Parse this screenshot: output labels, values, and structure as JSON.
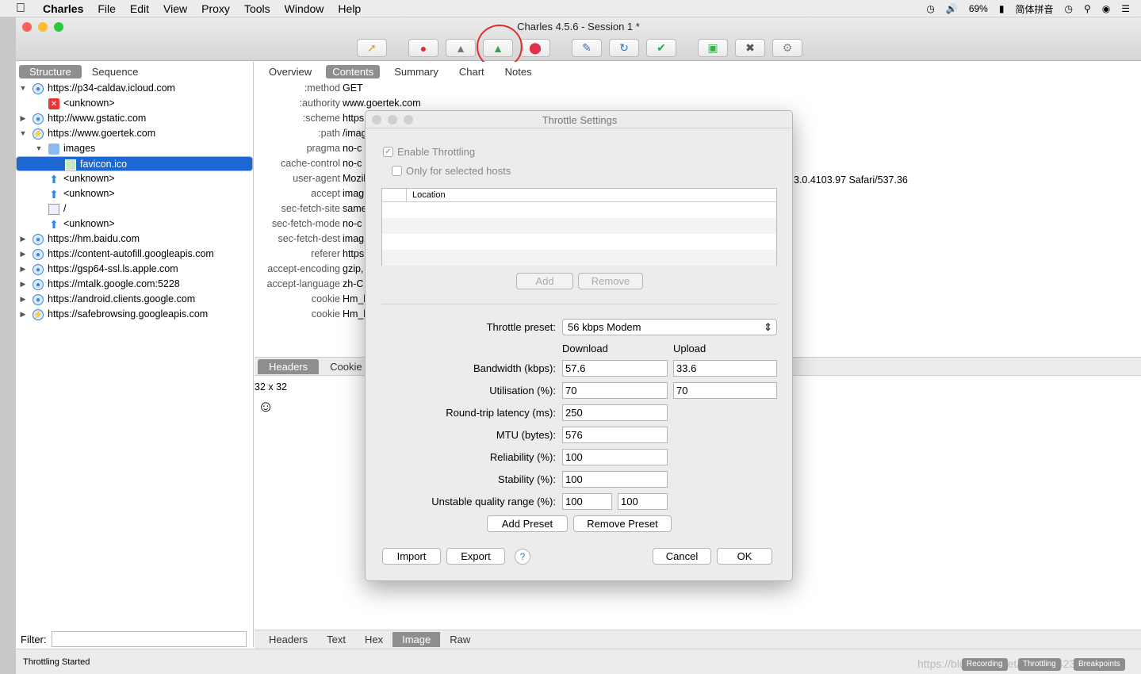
{
  "menubar": {
    "app": "Charles",
    "items": [
      "File",
      "Edit",
      "View",
      "Proxy",
      "Tools",
      "Window",
      "Help"
    ],
    "battery": "69%",
    "input_method": "简体拼音"
  },
  "window": {
    "title": "Charles 4.5.6 - Session 1 *"
  },
  "toolbar": {
    "buttons": [
      "broom-icon",
      "record-icon",
      "ssl-lock-icon",
      "throttle-turtle-icon",
      "breakpoint-stop-icon",
      "compose-pen-icon",
      "refresh-icon",
      "validate-check-icon",
      "basket-icon",
      "tools-icon",
      "settings-gear-icon"
    ]
  },
  "left": {
    "tabs": {
      "structure": "Structure",
      "sequence": "Sequence"
    },
    "tree": [
      {
        "label": "https://p34-caldav.icloud.com"
      },
      {
        "label": "<unknown>"
      },
      {
        "label": "http://www.gstatic.com"
      },
      {
        "label": "https://www.goertek.com"
      },
      {
        "label": "images"
      },
      {
        "label": "favicon.ico"
      },
      {
        "label": "<unknown>"
      },
      {
        "label": "<unknown>"
      },
      {
        "label": "/"
      },
      {
        "label": "<unknown>"
      },
      {
        "label": "https://hm.baidu.com"
      },
      {
        "label": "https://content-autofill.googleapis.com"
      },
      {
        "label": "https://gsp64-ssl.ls.apple.com"
      },
      {
        "label": "https://mtalk.google.com:5228"
      },
      {
        "label": "https://android.clients.google.com"
      },
      {
        "label": "https://safebrowsing.googleapis.com"
      }
    ],
    "filter_label": "Filter:"
  },
  "right": {
    "tabs": {
      "overview": "Overview",
      "contents": "Contents",
      "summary": "Summary",
      "chart": "Chart",
      "notes": "Notes"
    },
    "headers": [
      {
        "k": ":method",
        "v": "GET"
      },
      {
        "k": ":authority",
        "v": "www.goertek.com"
      },
      {
        "k": ":scheme",
        "v": "https"
      },
      {
        "k": ":path",
        "v": "/imag"
      },
      {
        "k": "pragma",
        "v": "no-c"
      },
      {
        "k": "cache-control",
        "v": "no-c"
      },
      {
        "k": "user-agent",
        "v": "Mozil"
      },
      {
        "k": "accept",
        "v": "imag"
      },
      {
        "k": "sec-fetch-site",
        "v": "same"
      },
      {
        "k": "sec-fetch-mode",
        "v": "no-c"
      },
      {
        "k": "sec-fetch-dest",
        "v": "imag"
      },
      {
        "k": "referer",
        "v": "https"
      },
      {
        "k": "accept-encoding",
        "v": "gzip,"
      },
      {
        "k": "accept-language",
        "v": "zh-C"
      },
      {
        "k": "cookie",
        "v": "Hm_l"
      },
      {
        "k": "cookie",
        "v": "Hm_l"
      }
    ],
    "ua_tail": "3.0.4103.97 Safari/537.36",
    "lower_tabs": {
      "headers": "Headers",
      "cookies": "Cookie"
    },
    "image_dim": "32 x 32",
    "bottom_tabs": {
      "headers": "Headers",
      "text": "Text",
      "hex": "Hex",
      "image": "Image",
      "raw": "Raw"
    }
  },
  "status": {
    "text": "Throttling Started",
    "recording": "Recording",
    "throttling": "Throttling",
    "breakpoints": "Breakpoints",
    "watermark": "https://blog.csdn.net/weixin_42382520"
  },
  "dialog": {
    "title": "Throttle Settings",
    "enable_throttling": "Enable Throttling",
    "only_selected": "Only for selected hosts",
    "location_header": "Location",
    "add": "Add",
    "remove": "Remove",
    "preset_label": "Throttle preset:",
    "preset_value": "56 kbps Modem",
    "col_download": "Download",
    "col_upload": "Upload",
    "bandwidth_label": "Bandwidth (kbps):",
    "bandwidth_down": "57.6",
    "bandwidth_up": "33.6",
    "utilisation_label": "Utilisation (%):",
    "utilisation_down": "70",
    "utilisation_up": "70",
    "latency_label": "Round-trip latency (ms):",
    "latency": "250",
    "mtu_label": "MTU (bytes):",
    "mtu": "576",
    "reliability_label": "Reliability (%):",
    "reliability": "100",
    "stability_label": "Stability (%):",
    "stability": "100",
    "unstable_label": "Unstable quality range (%):",
    "unstable_min": "100",
    "unstable_max": "100",
    "add_preset": "Add Preset",
    "remove_preset": "Remove Preset",
    "import": "Import",
    "export": "Export",
    "help": "?",
    "cancel": "Cancel",
    "ok": "OK"
  }
}
